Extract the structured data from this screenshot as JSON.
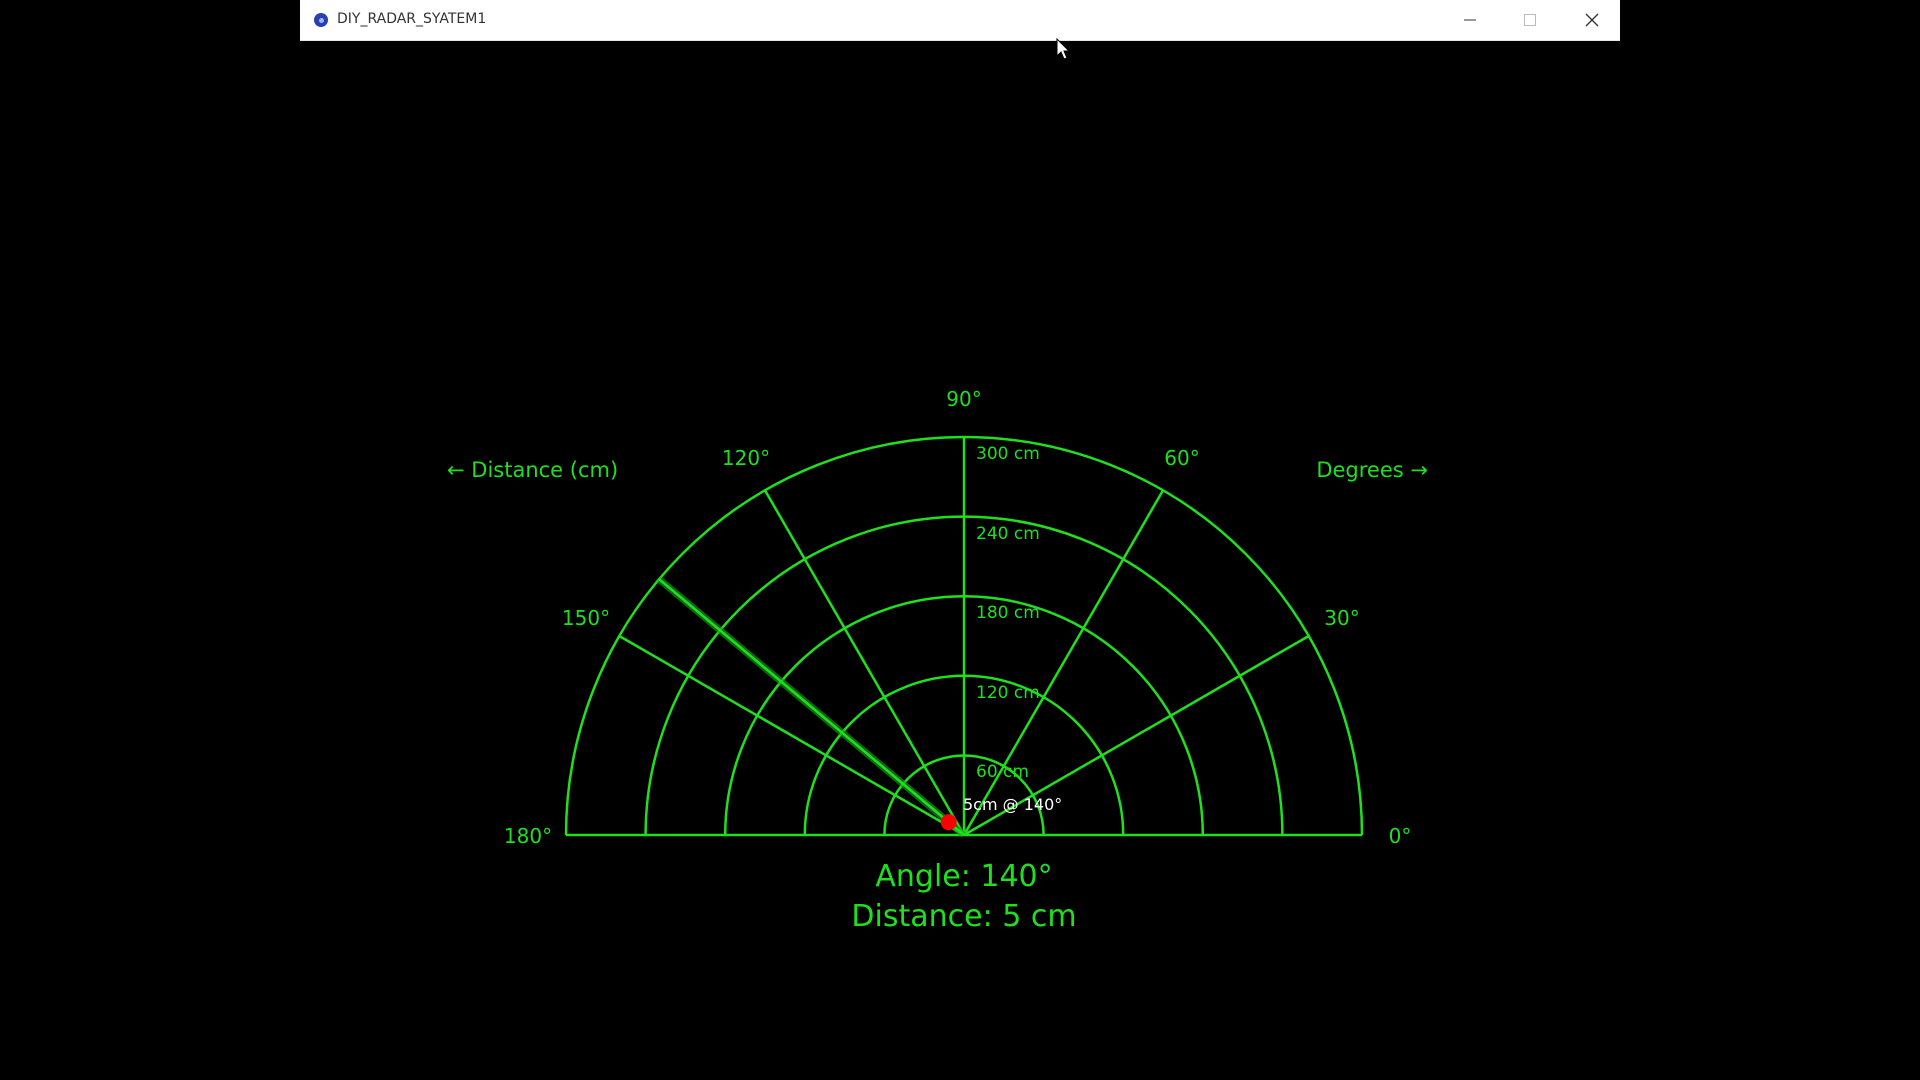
{
  "window": {
    "title": "DIY_RADAR_SYATEM1"
  },
  "radar": {
    "color": "#1fe01f",
    "target_color": "#ff0000",
    "angle_labels": {
      "deg0": "0°",
      "deg30": "30°",
      "deg60": "60°",
      "deg90": "90°",
      "deg120": "120°",
      "deg150": "150°",
      "deg180": "180°"
    },
    "range_labels": {
      "r60": "60 cm",
      "r120": "120 cm",
      "r180": "180 cm",
      "r240": "240 cm",
      "r300": "300 cm"
    },
    "legend_left": "← Distance (cm)",
    "legend_right": "Degrees →",
    "target_label": "5cm @ 140°",
    "angle_readout": "Angle: 140°",
    "distance_readout": "Distance: 5 cm",
    "sweep_angle_deg": 140,
    "target_distance_cm": 5,
    "max_range_cm": 300
  }
}
